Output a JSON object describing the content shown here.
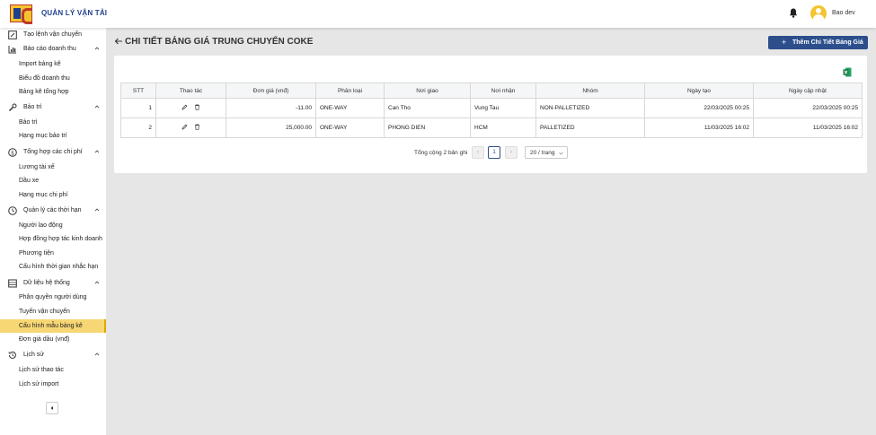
{
  "header": {
    "app_title": "QUẢN LÝ VẬN TẢI",
    "username": "Bao dev"
  },
  "sidebar": {
    "groups": [
      {
        "label": "Tạo lệnh vận chuyển",
        "icon": "edit-box-icon"
      },
      {
        "label": "Báo cáo doanh thu",
        "icon": "bar-chart-icon",
        "items": [
          "Import bảng kê",
          "Biểu đồ doanh thu",
          "Bảng kê tổng hợp"
        ]
      },
      {
        "label": "Bảo trì",
        "icon": "wrench-icon",
        "items": [
          "Bảo trì",
          "Hạng mục bảo trì"
        ]
      },
      {
        "label": "Tổng hợp các chi phí",
        "icon": "dollar-icon",
        "items": [
          "Lương tài xế",
          "Dầu xe",
          "Hạng mục chi phí"
        ]
      },
      {
        "label": "Quản lý các thời hạn",
        "icon": "clock-icon",
        "items": [
          "Người lao động",
          "Hợp đồng hợp tác kinh doanh",
          "Phương tiện",
          "Cấu hình thời gian nhắc hạn"
        ]
      },
      {
        "label": "Dữ liệu hệ thống",
        "icon": "database-icon",
        "items": [
          "Phân quyền người dùng",
          "Tuyến vận chuyển",
          "Cấu hình mẫu bảng kê",
          "Đơn giá dầu (vnđ)"
        ]
      },
      {
        "label": "Lịch sử",
        "icon": "history-icon",
        "items": [
          "Lịch sử thao tác",
          "Lịch sử import"
        ]
      }
    ],
    "active_item": "Cấu hình mẫu bảng kê"
  },
  "page": {
    "title": "CHI TIẾT BẢNG GIÁ TRUNG CHUYỂN COKE",
    "add_button": "Thêm Chi Tiết Bảng Giá"
  },
  "table": {
    "columns": [
      "STT",
      "Thao tác",
      "Đơn giá (vnđ)",
      "Phân loại",
      "Nơi giao",
      "Nơi nhận",
      "Nhóm",
      "Ngày tạo",
      "Ngày cập nhật"
    ],
    "rows": [
      {
        "stt": "1",
        "price": "-11.00",
        "type": "ONE-WAY",
        "from": "Can Tho",
        "to": "Vung Tau",
        "group": "NON-PALLETIZED",
        "created": "22/03/2025 00:25",
        "updated": "22/03/2025 00:25"
      },
      {
        "stt": "2",
        "price": "25,000.00",
        "type": "ONE-WAY",
        "from": "PHONG DIEN",
        "to": "HCM",
        "group": "PALLETIZED",
        "created": "11/03/2025 16:02",
        "updated": "11/03/2025 16:02"
      }
    ]
  },
  "pagination": {
    "total": "Tổng cộng 2 bản ghi",
    "current_page": "1",
    "page_size": "20 / trang"
  },
  "colors": {
    "primary": "#2c4f8c",
    "active_bg": "#f7d774",
    "excel": "#1d7a45"
  }
}
